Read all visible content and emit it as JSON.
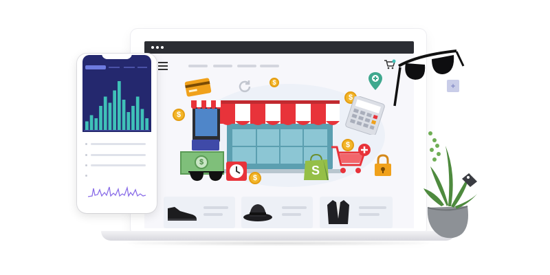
{
  "illustration": {
    "currency_symbol": "$",
    "plus_symbol": "+",
    "store_brand_letter": "S",
    "accent_colors": {
      "awning_red": "#e8333a",
      "phone_dark": "#24286e",
      "chart_teal": "#3fc1b8",
      "coin_gold": "#f3b62a",
      "lock_orange": "#f0a11b",
      "shopify_green": "#95bf47",
      "spark_purple": "#8a6de8"
    },
    "phone_chart": {
      "bars": [
        3,
        5,
        4,
        8,
        11,
        9,
        13,
        16,
        10,
        6,
        8,
        11,
        7,
        4
      ]
    },
    "icons": [
      "credit-card-icon",
      "coin-icon",
      "storefront-icon",
      "smartphone-icon",
      "calculator-icon",
      "shopping-cart-icon",
      "padlock-icon",
      "cash-stack-icon",
      "alarm-clock-icon",
      "sunglasses-icon",
      "shopping-bag-icon",
      "refresh-icon",
      "location-pin-icon",
      "plant-icon",
      "price-tag-icon"
    ],
    "product_cards": [
      "shoe",
      "hat",
      "jacket"
    ]
  }
}
